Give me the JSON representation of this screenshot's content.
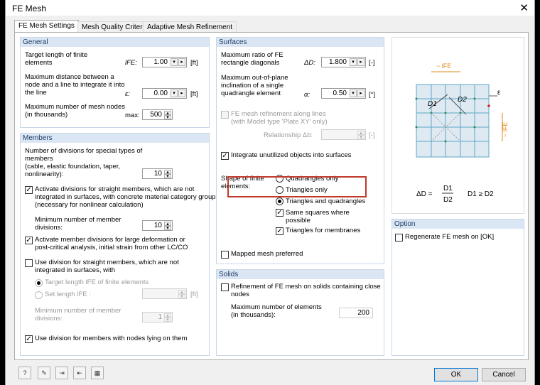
{
  "window": {
    "title": "FE Mesh",
    "close_glyph": "✕"
  },
  "tabs": [
    "FE Mesh Settings",
    "Mesh Quality Criteria",
    "Adaptive Mesh Refinement"
  ],
  "general": {
    "header": "General",
    "target_label_1": "Target length of finite",
    "target_label_2": "elements",
    "target_sym": "lFE:",
    "target_value": "1.00",
    "target_unit": "[ft]",
    "maxdist_label_1": "Maximum distance between a",
    "maxdist_label_2": "node and a line to integrate it into",
    "maxdist_label_3": "the line",
    "maxdist_sym": "ε:",
    "maxdist_value": "0.00",
    "maxdist_unit": "[ft]",
    "maxnodes_label_1": "Maximum number of mesh nodes",
    "maxnodes_label_2": "(in thousands)",
    "maxnodes_sym": "max:",
    "maxnodes_value": "500"
  },
  "members": {
    "header": "Members",
    "div_label_1": "Number of divisions for special types of",
    "div_label_2": "members",
    "div_label_3": "(cable, elastic foundation, taper,",
    "div_label_4": "nonlinearity):",
    "div_value": "10",
    "act_label_1": "Activate divisions for straight members, which are not",
    "act_label_2": "integrated in surfaces, with concrete material category group",
    "act_label_3": "(necessary for nonlinear calculation)",
    "min_label_1": "Minimum number of member",
    "min_label_2": "divisions:",
    "min_value": "10",
    "large_label_1": "Activate member divisions for large deformation or",
    "large_label_2": "post-critical analysis, initial strain from other LC/CO",
    "usediv_label_1": "Use division for straight members, which are not",
    "usediv_label_2": "integrated in surfaces, with",
    "target_opt": "Target length lFE of finite elements",
    "setlen_opt": "Set length lFE :",
    "setlen_unit": "[ft]",
    "min2_label_1": "Minimum number of member",
    "min2_label_2": "divisions:",
    "min2_value": "1",
    "nodes_label": "Use division for members with nodes lying on them"
  },
  "surfaces": {
    "header": "Surfaces",
    "ratio_label_1": "Maximum ratio of FE",
    "ratio_label_2": "rectangle diagonals",
    "ratio_sym": "ΔD:",
    "ratio_value": "1.800",
    "ratio_unit": "[-]",
    "oop_label_1": "Maximum out-of-plane",
    "oop_label_2": "inclination of a single",
    "oop_label_3": "quadrangle element",
    "oop_sym": "α:",
    "oop_value": "0.50",
    "oop_unit": "[°]",
    "refine_label_1": "FE mesh refinement along lines",
    "refine_label_2": "(with Model type 'Plate XY' only)",
    "rel_label": "Relationship Δb:",
    "rel_unit": "[-]",
    "integrate_label": "Integrate unutilized objects into surfaces",
    "shape_label_1": "Shape of finite",
    "shape_label_2": "elements:",
    "opt_quad": "Quadrangles only",
    "opt_tri": "Triangles only",
    "opt_both": "Triangles and quadrangles",
    "same_sq_1": "Same squares where",
    "same_sq_2": "possible",
    "tri_memb": "Triangles for membranes",
    "mapped": "Mapped mesh preferred"
  },
  "solids": {
    "header": "Solids",
    "refine_1": "Refinement of FE mesh on solids containing close",
    "refine_2": "nodes",
    "max_label_1": "Maximum number of elements",
    "max_label_2": "(in thousands):",
    "max_value": "200"
  },
  "diagram": {
    "lfe_top": "~ lFE",
    "eps": "ε",
    "lfe_side": "~ lFE",
    "d1": "D1",
    "d2": "D2",
    "delta": "ΔD =",
    "frac_top": "D1",
    "frac_bot": "D2",
    "cond": "D1 ≥ D2"
  },
  "option": {
    "header": "Option",
    "regen": "Regenerate FE mesh on [OK]"
  },
  "buttons": {
    "ok": "OK",
    "cancel": "Cancel"
  },
  "bottom_icons": [
    "help-icon",
    "edit-icon",
    "export-icon",
    "import-icon",
    "units-icon"
  ],
  "colors": {
    "group_header": "#dbe6f4",
    "highlight": "#c0392b",
    "default_button": "#0078d7"
  }
}
